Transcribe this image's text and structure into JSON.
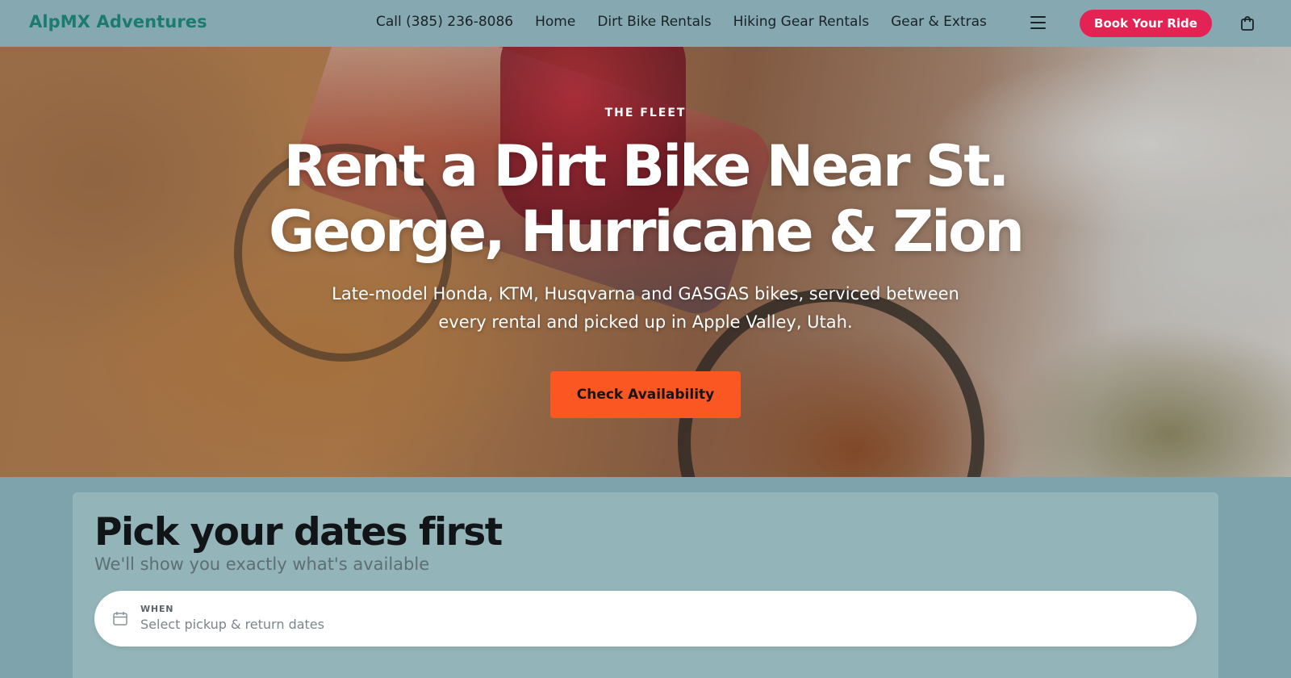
{
  "brand": {
    "name": "AlpMX Adventures",
    "color": "#1b7b6f"
  },
  "nav": {
    "items": [
      {
        "label": "Call (385) 236-8086"
      },
      {
        "label": "Home"
      },
      {
        "label": "Dirt Bike Rentals"
      },
      {
        "label": "Hiking Gear Rentals"
      },
      {
        "label": "Gear & Extras"
      }
    ],
    "menu_icon": "hamburger-icon",
    "cta_label": "Book Your Ride",
    "cta_color": "#e22353",
    "cart_icon": "shopping-bag-icon"
  },
  "hero": {
    "eyebrow": "THE FLEET",
    "title": "Rent a Dirt Bike Near St. George, Hurricane & Zion",
    "subtitle": "Late-model Honda, KTM, Husqvarna and GASGAS bikes, serviced between every rental and picked up in Apple Valley, Utah.",
    "cta_label": "Check Availability",
    "cta_color": "#fa5722"
  },
  "booking": {
    "title": "Pick your dates first",
    "subtitle": "We'll show you exactly what's available",
    "date_field": {
      "label": "WHEN",
      "placeholder": "Select pickup & return dates",
      "icon": "calendar-icon"
    }
  }
}
